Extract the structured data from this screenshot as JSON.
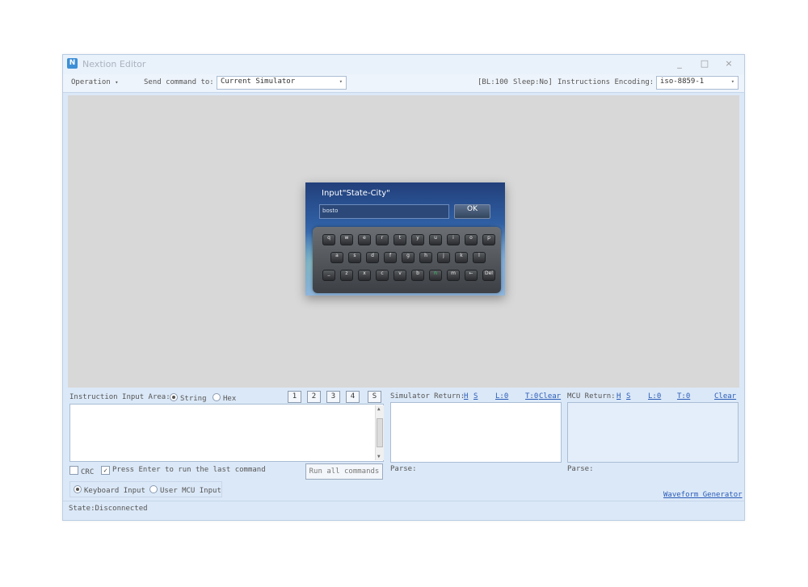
{
  "window": {
    "title": "Nextion Editor",
    "icon_letter": "N",
    "controls": {
      "minimize": "_",
      "maximize": "□",
      "close": "×"
    }
  },
  "toolbar": {
    "operation_label": "Operation",
    "send_command_label": "Send command to:",
    "send_command_value": "Current Simulator",
    "bl_status": "[BL:100",
    "sleep_status": "Sleep:No]",
    "encoding_label": "Instructions Encoding:",
    "encoding_value": "iso-8859-1"
  },
  "simulator_screen": {
    "title": "Input\"State-City\"",
    "input_value": "bosto",
    "ok_label": "OK",
    "keys_row1": [
      "q",
      "w",
      "e",
      "r",
      "t",
      "y",
      "u",
      "i",
      "o",
      "p"
    ],
    "keys_row2": [
      "a",
      "s",
      "d",
      "f",
      "g",
      "h",
      "j",
      "k",
      "l"
    ],
    "keys_row3": [
      "_",
      "z",
      "x",
      "c",
      "v",
      "b",
      "n",
      "m",
      "←",
      "Del"
    ],
    "active_key": "n"
  },
  "instruction_input": {
    "label": "Instruction Input Area:",
    "string_label": "String",
    "hex_label": "Hex",
    "selected_mode": "String",
    "macro_buttons": [
      "1",
      "2",
      "3",
      "4",
      "S"
    ],
    "value": ""
  },
  "options": {
    "crc_label": "CRC",
    "crc_checked": false,
    "press_enter_label": "Press Enter to run the last command",
    "press_enter_checked": true,
    "run_all_label": "Run all commands",
    "keyboard_input_label": "Keyboard Input",
    "user_mcu_input_label": "User MCU Input",
    "selected_input": "Keyboard Input"
  },
  "simulator_return": {
    "label": "Simulator Return:",
    "h": "H",
    "s": "S",
    "l": "L:0",
    "t": "T:0",
    "clear": "Clear",
    "parse_label": "Parse:"
  },
  "mcu_return": {
    "label": "MCU Return:",
    "h": "H",
    "s": "S",
    "l": "L:0",
    "t": "T:0",
    "clear": "Clear",
    "parse_label": "Parse:"
  },
  "waveform_link": "Waveform Generator",
  "status": "State:Disconnected"
}
